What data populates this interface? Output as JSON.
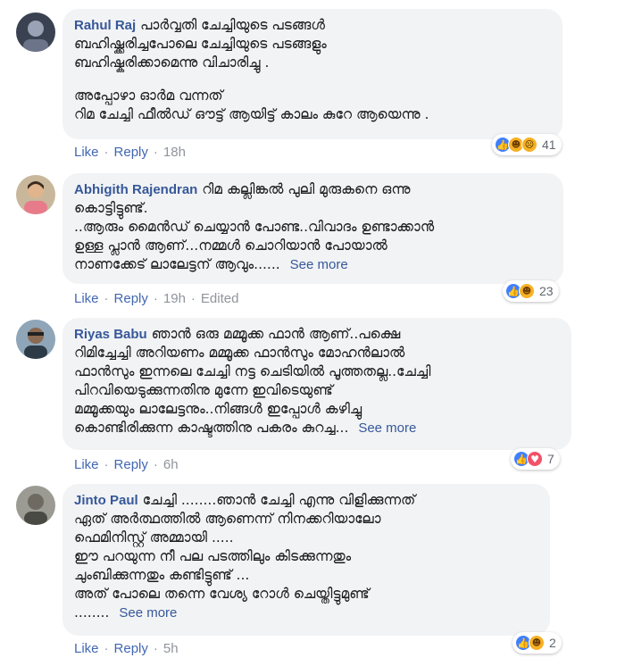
{
  "comments": [
    {
      "author": "Rahul Raj",
      "lines": [
        "പാർവ്വതി ചേച്ചിയുടെ പടങ്ങൾ",
        "ബഹിഷ്ക്കരിച്ചപോലെ ചേച്ചിയുടെ പടങ്ങളും",
        "ബഹിഷ്കരിക്കാമെന്നു വിചാരിച്ചു .",
        "",
        "അപ്പോഴാ ഓർമ വന്നത്",
        "റിമ ചേച്ചി ഫീൽഡ് ഔട്ട് ആയിട്ട് കാലം കുറേ ആയെന്നു ."
      ],
      "see_more": "",
      "like": "Like",
      "reply": "Reply",
      "time": "18h",
      "edited": "",
      "reactions": [
        "like-icon",
        "haha-icon",
        "sad-icon"
      ],
      "reaction_count": "41"
    },
    {
      "author": "Abhigith Rajendran",
      "lines": [
        "റിമ കല്ലിങ്കൽ പുലി മുരുകനെ ഒന്നു",
        "കൊട്ടിട്ടുണ്ട്.",
        "..ആരും മൈൻഡ് ചെയ്യാൻ പോണ്ട..വിവാദം ഉണ്ടാക്കാൻ",
        "ഉള്ള പ്ലാൻ ആണ്...നമ്മൾ ചൊറിയാൻ പോയാൽ",
        "നാണക്കേട് ലാലേട്ടന് ആവും......"
      ],
      "see_more": "See more",
      "like": "Like",
      "reply": "Reply",
      "time": "19h",
      "edited": "Edited",
      "reactions": [
        "like-icon",
        "haha-icon"
      ],
      "reaction_count": "23"
    },
    {
      "author": "Riyas Babu",
      "lines": [
        "ഞാൻ ഒരു മമ്മൂക്ക ഫാൻ ആണ്..പക്ഷെ",
        "റിമിച്ചേച്ചി അറിയണം മമ്മൂക്ക ഫാൻസും മോഹൻലാൽ",
        "ഫാൻസും ഇന്നലെ ചേച്ചി നട്ട ചെടിയിൽ പൂത്തതല്ല..ചേച്ചി",
        "പിറവിയെടുക്കുന്നതിനു മുന്നേ ഇവിടെയുണ്ട്",
        "മമ്മൂക്കയും ലാലേട്ടനും..നിങ്ങൾ ഇപ്പോൾ കഴിച്ചു",
        "കൊണ്ടിരിക്കുന്ന കാഷ്ടത്തിനു പകരം കുറച്ച..."
      ],
      "see_more": "See more",
      "like": "Like",
      "reply": "Reply",
      "time": "6h",
      "edited": "",
      "reactions": [
        "like-icon",
        "love-icon"
      ],
      "reaction_count": "7"
    },
    {
      "author": "Jinto Paul",
      "lines": [
        "ചേച്ചി ........ഞാൻ ചേച്ചി എന്നു വിളിക്കുന്നത്",
        "ഏത് അർത്ഥത്തിൽ ആണെന്ന് നിനക്കറിയാലോ",
        "ഫെമിനിസ്റ്റ് അമ്മായി .....",
        "ഈ പറയുന്ന നീ പല പടത്തിലും കിടക്കുന്നതും",
        "ചുംബിക്കുന്നതും കണ്ടിട്ടുണ്ട് ...",
        "അത് പോലെ തന്നെ വേശ്യ റോൾ ചെയ്തിട്ടുമുണ്ട്",
        "........"
      ],
      "see_more": "See more",
      "like": "Like",
      "reply": "Reply",
      "time": "5h",
      "edited": "",
      "reactions": [
        "like-icon",
        "haha-icon"
      ],
      "reaction_count": "2"
    }
  ]
}
